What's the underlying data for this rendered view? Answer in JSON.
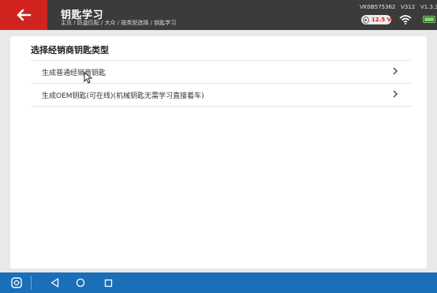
{
  "header": {
    "title": "钥匙学习",
    "breadcrumb": "主页 / 防盗匹配 / 大众 / 按类型选择 / 钥匙学习",
    "serial": "VK0B575362",
    "sw_version": "V312",
    "app_version": "V1.3.3",
    "voltage": "12.5 V",
    "accent_color": "#d1231f",
    "bar_color": "#3b3b3b"
  },
  "main": {
    "heading": "选择经销商钥匙类型",
    "options": [
      {
        "label": "生成普通经销商钥匙"
      },
      {
        "label": "生成OEM钥匙(可在线)(机械钥匙无需学习直接着车)"
      }
    ]
  },
  "navbar": {
    "color": "#1a6fb8",
    "icons": [
      "remote-icon",
      "back-triangle-icon",
      "home-circle-icon",
      "recent-square-icon"
    ]
  }
}
